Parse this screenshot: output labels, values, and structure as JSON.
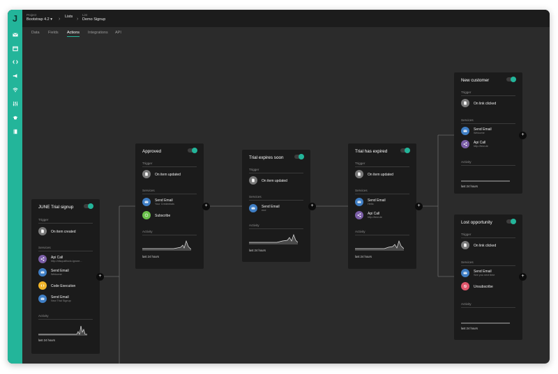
{
  "header": {
    "logo": "J",
    "project_label": "Project",
    "project_value": "Bootstrap 4.2 ▾",
    "lists_label": "Lists",
    "list_label": "List",
    "list_value": "Demo Signup"
  },
  "sidebar": {
    "icons": [
      "mail-icon",
      "inbox-icon",
      "sync-icon",
      "megaphone-icon",
      "wifi-icon",
      "sliders-icon",
      "graduation-cap-icon",
      "book-icon"
    ]
  },
  "tabs": [
    "Data",
    "Fields",
    "Actions",
    "Integrations",
    "API"
  ],
  "active_tab": "Actions",
  "colors": {
    "accent": "#23b59a",
    "purple": "#7b5ea7",
    "blue": "#3f7ec4",
    "yellow": "#f0b429",
    "green": "#6abf4b",
    "red": "#e0566b",
    "gray": "#7a7a7a"
  },
  "cards": {
    "june": {
      "title": "JUNE Trial signup",
      "trigger_label": "Trigger",
      "trigger": "On item created",
      "services_label": "Services",
      "services": [
        {
          "name": "Api Call",
          "sub": "http://disqusfbcdo.ignore...",
          "icon": "share-icon"
        },
        {
          "name": "Send Email",
          "sub": "Welcome",
          "icon": "envelope-icon"
        },
        {
          "name": "Code Execution",
          "sub": "",
          "icon": "code-icon"
        },
        {
          "name": "Send Email",
          "sub": "New Trial Signup",
          "icon": "envelope-icon"
        }
      ],
      "activity_label": "Activity",
      "last": "last 24 hours"
    },
    "approved": {
      "title": "Approved",
      "trigger_label": "Trigger",
      "trigger": "On item updated",
      "services_label": "Services",
      "services": [
        {
          "name": "Send Email",
          "sub": "Your Credentials",
          "icon": "envelope-icon"
        },
        {
          "name": "Subscribe",
          "sub": "",
          "icon": "whatsapp-icon"
        }
      ],
      "activity_label": "Activity",
      "last": "last 24 hours"
    },
    "trial_soon": {
      "title": "Trial expires soon",
      "trigger_label": "Trigger",
      "trigger": "On item updated",
      "services_label": "Services",
      "services": [
        {
          "name": "Send Email",
          "sub": "end",
          "icon": "envelope-icon"
        }
      ],
      "activity_label": "Activity",
      "last": "last 24 hours"
    },
    "trial_expired": {
      "title": "Trial has expired",
      "trigger_label": "Trigger",
      "trigger": "On item updated",
      "services_label": "Services",
      "services": [
        {
          "name": "Send Email",
          "sub": "Hello",
          "icon": "envelope-icon"
        },
        {
          "name": "Api Call",
          "sub": "http://test.de",
          "icon": "share-icon"
        }
      ],
      "activity_label": "Activity",
      "last": "last 24 hours"
    },
    "new_customer": {
      "title": "New customer",
      "trigger_label": "Trigger",
      "trigger": "On link clicked",
      "services_label": "Services",
      "services": [
        {
          "name": "Send Email",
          "sub": "Welcome",
          "icon": "envelope-icon"
        },
        {
          "name": "Api Call",
          "sub": "http://test.de",
          "icon": "share-icon"
        }
      ],
      "activity_label": "Activity",
      "last": "last 24 hours"
    },
    "lost": {
      "title": "Lost opportunity",
      "trigger_label": "Trigger",
      "trigger": "On link clicked",
      "services_label": "Services",
      "services": [
        {
          "name": "Send Email",
          "sub": "See you next time",
          "icon": "envelope-icon"
        },
        {
          "name": "Unsubscribe",
          "sub": "",
          "icon": "block-icon"
        }
      ],
      "activity_label": "Activity",
      "last": "last 24 hours"
    }
  },
  "add_button": "+"
}
